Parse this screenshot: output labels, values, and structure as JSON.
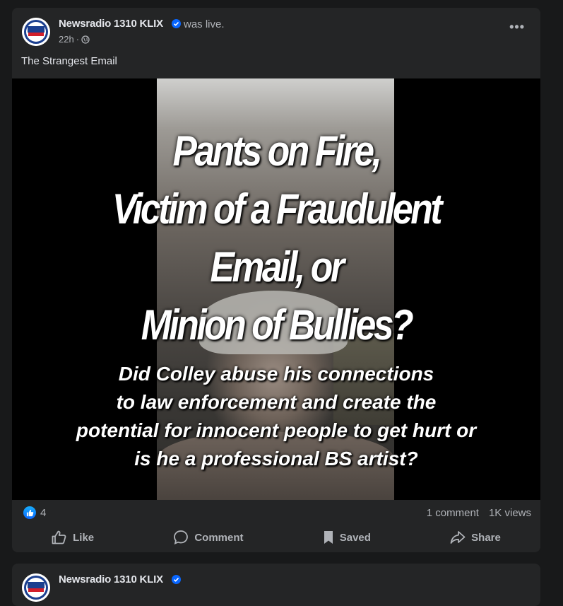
{
  "post": {
    "page_name": "Newsradio 1310 KLIX",
    "status": "was live.",
    "time": "22h",
    "time_separator": "·",
    "more_label": "•••",
    "caption": "The Strangest Email",
    "avatar_logo_text": "KLIX",
    "avatar_logo_subtext": "NEWS RADIO",
    "video": {
      "headline_lines": [
        "Pants on Fire,",
        "Victim of a Fraudulent",
        "Email, or",
        "Minion of Bullies?"
      ],
      "subhead_lines": [
        "Did Colley abuse his connections",
        "to law enforcement and create the",
        "potential for innocent people to get hurt or",
        "is he a professional BS artist?"
      ]
    },
    "reaction_count": "4",
    "comments": "1 comment",
    "views": "1K views",
    "actions": {
      "like": "Like",
      "comment": "Comment",
      "saved": "Saved",
      "share": "Share"
    }
  },
  "next_post": {
    "page_name": "Newsradio 1310 KLIX"
  },
  "colors": {
    "background": "#18191a",
    "card": "#242526",
    "primary_text": "#e4e6eb",
    "secondary_text": "#b0b3b8",
    "accent": "#0866ff"
  },
  "icons": [
    "verified-badge-icon",
    "globe-icon",
    "more-options-icon",
    "like-reaction-icon",
    "like-icon",
    "comment-icon",
    "saved-bookmark-icon",
    "share-icon"
  ]
}
